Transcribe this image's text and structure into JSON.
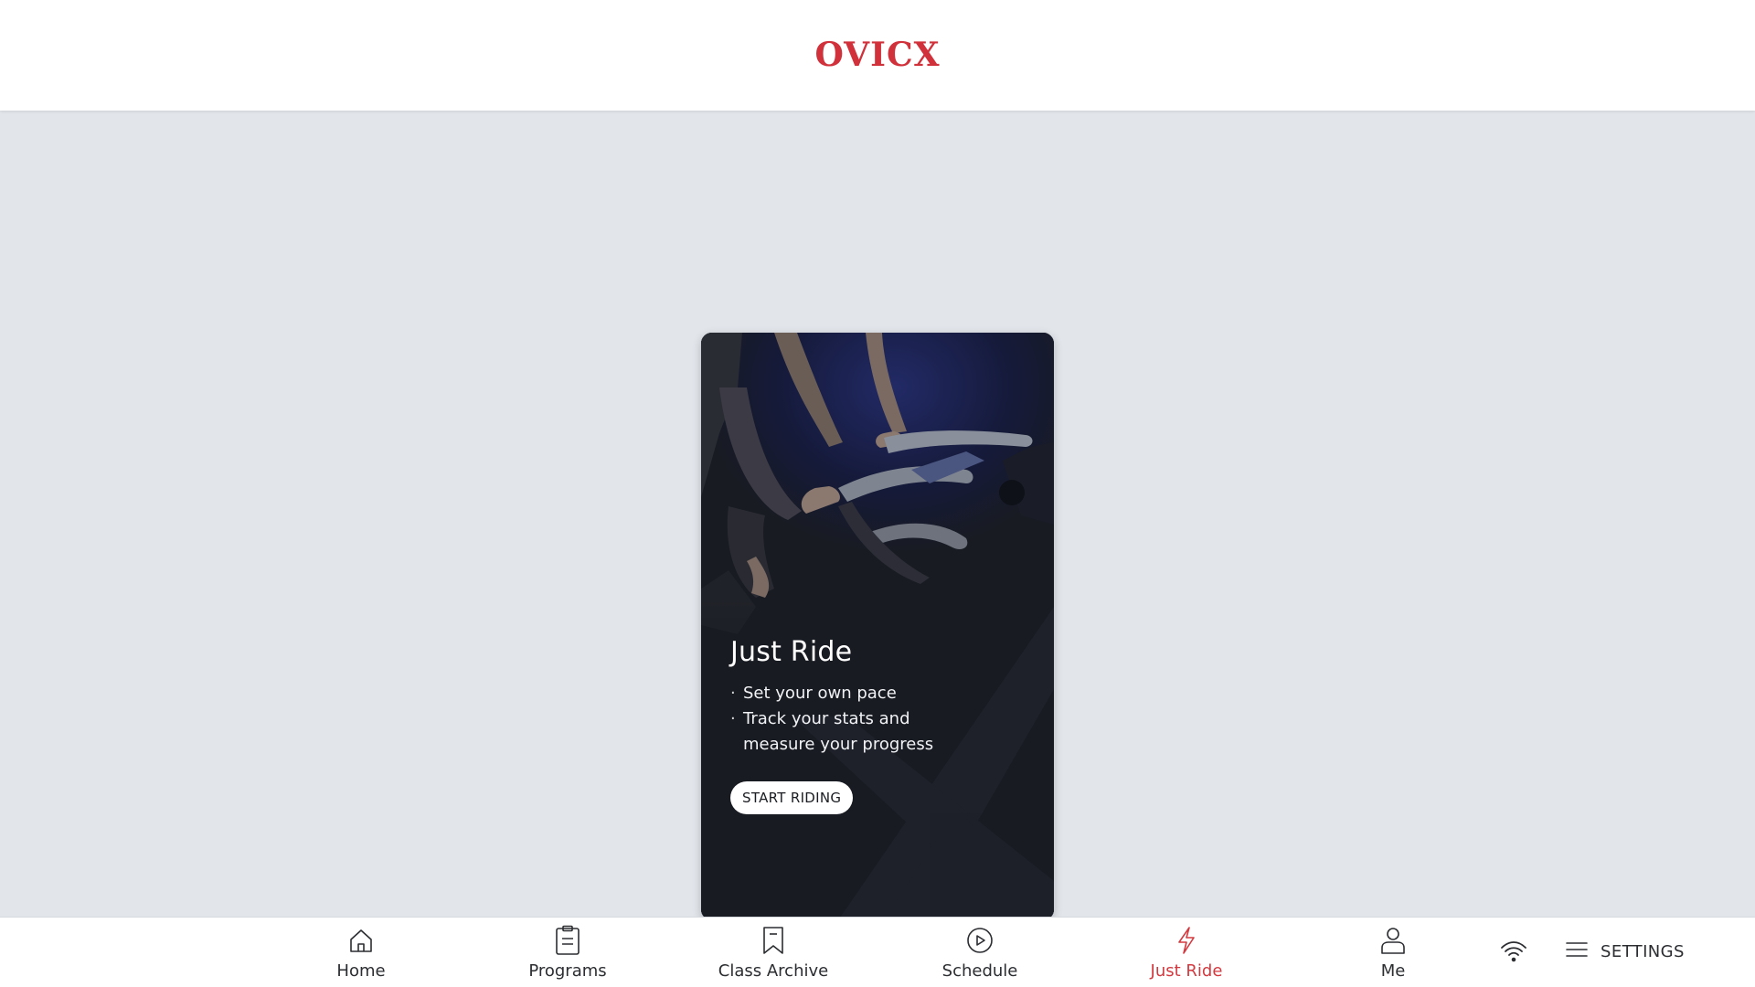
{
  "header": {
    "logo_text": "OVICX"
  },
  "card": {
    "title": "Just Ride",
    "bullets": [
      "Set your own pace",
      "Track your stats and measure your progress"
    ],
    "button_label": "START RIDING",
    "image_subject": "indoor cycling bike handlebars"
  },
  "nav": {
    "items": [
      {
        "label": "Home",
        "icon": "home-icon"
      },
      {
        "label": "Programs",
        "icon": "clipboard-icon"
      },
      {
        "label": "Class Archive",
        "icon": "bookmark-icon"
      },
      {
        "label": "Schedule",
        "icon": "play-circle-icon"
      },
      {
        "label": "Just Ride",
        "icon": "lightning-icon",
        "active": true
      },
      {
        "label": "Me",
        "icon": "user-icon"
      }
    ],
    "wifi_icon": "wifi-icon",
    "settings_label": "SETTINGS"
  },
  "colors": {
    "accent": "#d23a40",
    "background": "#e2e6eb",
    "card_background": "#181b22"
  }
}
